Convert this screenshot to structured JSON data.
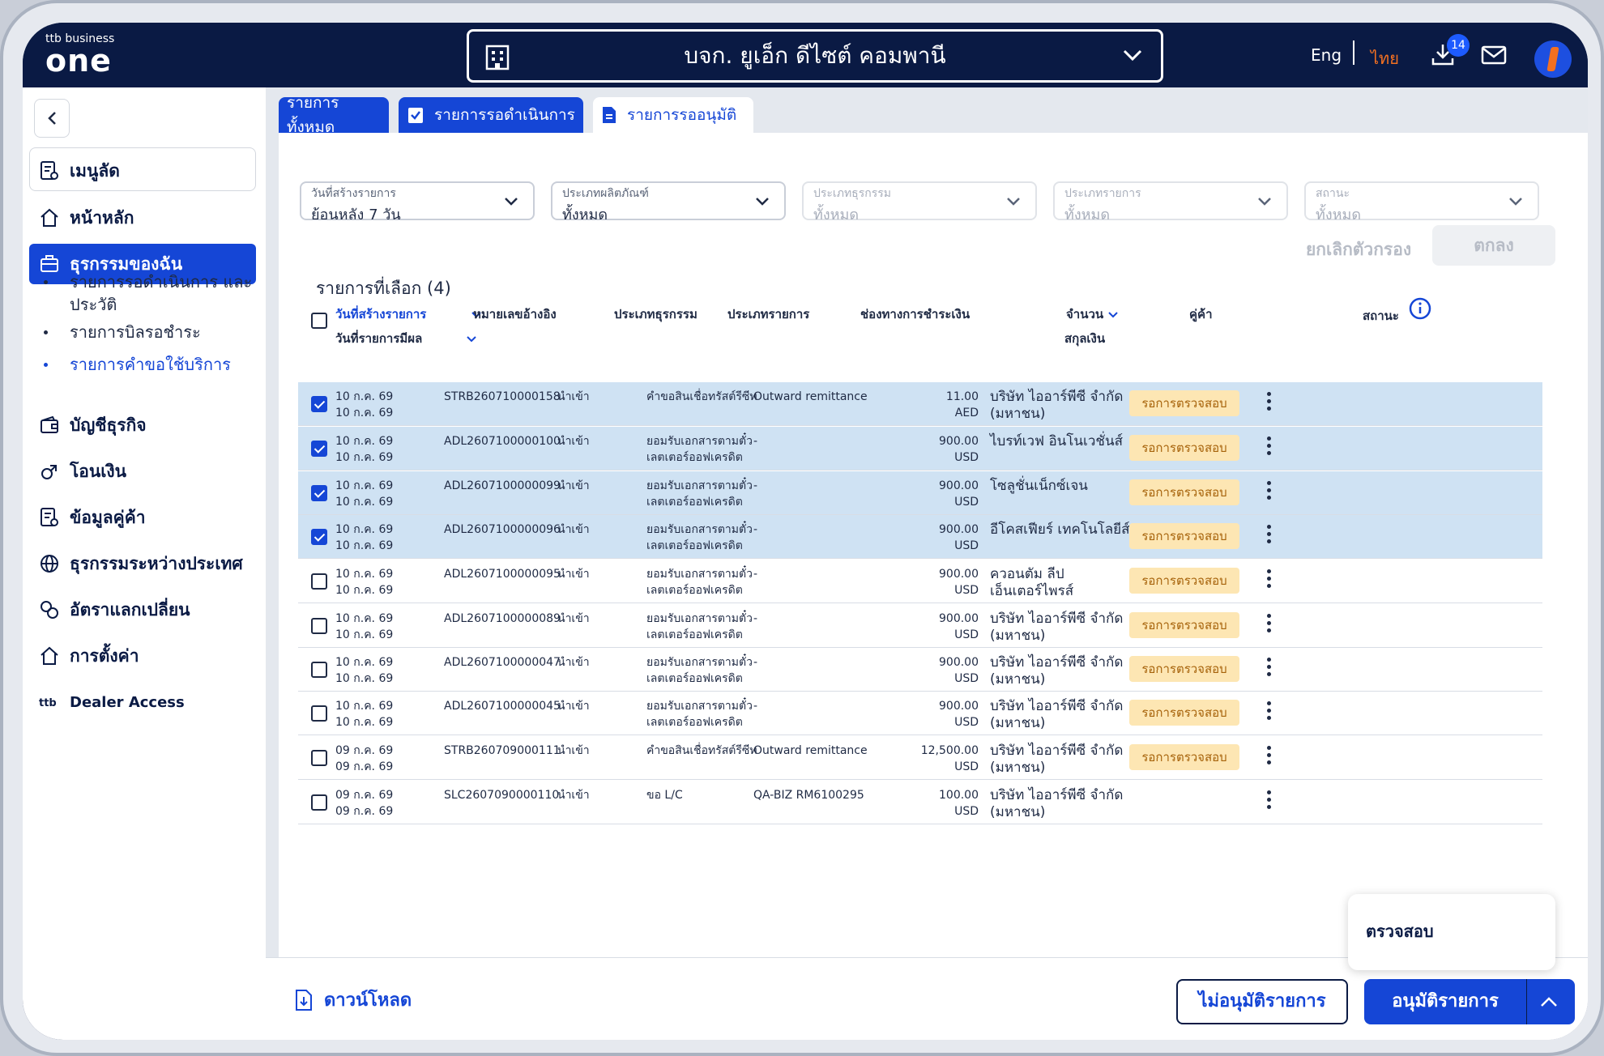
{
  "header": {
    "logo_top": "ttb business",
    "logo_main": "one",
    "company": "บจก. ยูเอ็ก ดีไซต์ คอมพานี",
    "lang_en": "Eng",
    "lang_th": "ไทย",
    "download_badge": "14",
    "colors": {
      "navy": "#0a1a44",
      "accent": "#f37021",
      "primary": "#1546d6"
    }
  },
  "sidebar": {
    "shortcut": "เมนูลัด",
    "items": [
      {
        "label": "หน้าหลัก",
        "icon": "home-icon"
      },
      {
        "label": "ธุรกรรมของฉัน",
        "icon": "briefcase-icon"
      },
      {
        "label": "บัญชีธุรกิจ",
        "icon": "wallet-icon"
      },
      {
        "label": "โอนเงิน",
        "icon": "transfer-icon"
      },
      {
        "label": "ข้อมูลคู่ค้า",
        "icon": "document-icon"
      },
      {
        "label": "ธุรกรรมระหว่างประเทศ",
        "icon": "globe-icon"
      },
      {
        "label": "อัตราแลกเปลี่ยน",
        "icon": "exchange-icon"
      },
      {
        "label": "การตั้งค่า",
        "icon": "settings-icon"
      },
      {
        "label": "Dealer Access",
        "icon": "ttb-icon"
      }
    ],
    "sub_items": [
      {
        "label": "รายการรอดำเนินการ และประวัติ"
      },
      {
        "label": "รายการบิลรอชำระ"
      },
      {
        "label": "รายการคำขอใช้บริการ"
      }
    ]
  },
  "tabs": {
    "all": "รายการทั้งหมด",
    "pending": "รายการรอดำเนินการ",
    "approve": "รายการรออนุมัติ"
  },
  "filters": [
    {
      "label": "วันที่สร้างรายการ",
      "value": "ย้อนหลัง 7 วัน"
    },
    {
      "label": "ประเภทผลิตภัณฑ์",
      "value": "ทั้งหมด"
    },
    {
      "label": "ประเภทธุรกรรม",
      "value": "ทั้งหมด"
    },
    {
      "label": "ประเภทรายการ",
      "value": "ทั้งหมด"
    },
    {
      "label": "สถานะ",
      "value": "ทั้งหมด"
    }
  ],
  "filter_actions": {
    "clear": "ยกเลิกตัวกรอง",
    "ok": "ตกลง"
  },
  "selected_count": "รายการที่เลือก (4)",
  "table": {
    "headers": {
      "created": "วันที่สร้างรายการ",
      "effective": "วันที่รายการมีผล",
      "ref": "หมายเลขอ้างอิง",
      "txn_type": "ประเภทธุรกรรม",
      "item_type": "ประเภทรายการ",
      "channel": "ช่องทางการชำระเงิน",
      "amount": "จำนวน",
      "currency": "สกุลเงิน",
      "partner": "คู่ค้า",
      "status": "สถานะ"
    },
    "rows": [
      {
        "checked": true,
        "created": "10 ก.ค. 69",
        "effective": "10 ก.ค. 69",
        "ref": "STRB260710000158",
        "txn": "นำเข้า",
        "item1": "คำขอสินเชื่อทรัสต์รีซีท",
        "item2": "",
        "channel": "Outward remittance",
        "amount": "11.00",
        "currency": "AED",
        "partner1": "บริษัท ไออาร์พีซี จำกัด",
        "partner2": "(มหาชน)",
        "status": "รอการตรวจสอบ"
      },
      {
        "checked": true,
        "created": "10 ก.ค. 69",
        "effective": "10 ก.ค. 69",
        "ref": "ADL2607100000100",
        "txn": "นำเข้า",
        "item1": "ยอมรับเอกสารตามตั๋ว",
        "item2": "เลตเตอร์ออฟเครดิต",
        "channel": "-",
        "amount": "900.00",
        "currency": "USD",
        "partner1": "ไบรท์เวฟ อินโนเวชั่นส์",
        "partner2": "",
        "status": "รอการตรวจสอบ"
      },
      {
        "checked": true,
        "created": "10 ก.ค. 69",
        "effective": "10 ก.ค. 69",
        "ref": "ADL2607100000099",
        "txn": "นำเข้า",
        "item1": "ยอมรับเอกสารตามตั๋ว",
        "item2": "เลตเตอร์ออฟเครดิต",
        "channel": "-",
        "amount": "900.00",
        "currency": "USD",
        "partner1": "โซลูชั่นเน็กซ์เจน",
        "partner2": "",
        "status": "รอการตรวจสอบ"
      },
      {
        "checked": true,
        "created": "10 ก.ค. 69",
        "effective": "10 ก.ค. 69",
        "ref": "ADL2607100000096",
        "txn": "นำเข้า",
        "item1": "ยอมรับเอกสารตามตั๋ว",
        "item2": "เลตเตอร์ออฟเครดิต",
        "channel": "-",
        "amount": "900.00",
        "currency": "USD",
        "partner1": "อีโคสเฟียร์ เทคโนโลยีส์",
        "partner2": "",
        "status": "รอการตรวจสอบ"
      },
      {
        "checked": false,
        "created": "10 ก.ค. 69",
        "effective": "10 ก.ค. 69",
        "ref": "ADL2607100000095",
        "txn": "นำเข้า",
        "item1": "ยอมรับเอกสารตามตั๋ว",
        "item2": "เลตเตอร์ออฟเครดิต",
        "channel": "-",
        "amount": "900.00",
        "currency": "USD",
        "partner1": "ควอนตัม ลีป",
        "partner2": "เอ็นเตอร์ไพรส์",
        "status": "รอการตรวจสอบ"
      },
      {
        "checked": false,
        "created": "10 ก.ค. 69",
        "effective": "10 ก.ค. 69",
        "ref": "ADL2607100000089",
        "txn": "นำเข้า",
        "item1": "ยอมรับเอกสารตามตั๋ว",
        "item2": "เลตเตอร์ออฟเครดิต",
        "channel": "-",
        "amount": "900.00",
        "currency": "USD",
        "partner1": "บริษัท ไออาร์พีซี จำกัด",
        "partner2": "(มหาชน)",
        "status": "รอการตรวจสอบ"
      },
      {
        "checked": false,
        "created": "10 ก.ค. 69",
        "effective": "10 ก.ค. 69",
        "ref": "ADL2607100000047",
        "txn": "นำเข้า",
        "item1": "ยอมรับเอกสารตามตั๋ว",
        "item2": "เลตเตอร์ออฟเครดิต",
        "channel": "-",
        "amount": "900.00",
        "currency": "USD",
        "partner1": "บริษัท ไออาร์พีซี จำกัด",
        "partner2": "(มหาชน)",
        "status": "รอการตรวจสอบ"
      },
      {
        "checked": false,
        "created": "10 ก.ค. 69",
        "effective": "10 ก.ค. 69",
        "ref": "ADL2607100000045",
        "txn": "นำเข้า",
        "item1": "ยอมรับเอกสารตามตั๋ว",
        "item2": "เลตเตอร์ออฟเครดิต",
        "channel": "-",
        "amount": "900.00",
        "currency": "USD",
        "partner1": "บริษัท ไออาร์พีซี จำกัด",
        "partner2": "(มหาชน)",
        "status": "รอการตรวจสอบ"
      },
      {
        "checked": false,
        "created": "09 ก.ค. 69",
        "effective": "09 ก.ค. 69",
        "ref": "STRB260709000111",
        "txn": "นำเข้า",
        "item1": "คำขอสินเชื่อทรัสต์รีซีท",
        "item2": "",
        "channel": "Outward remittance",
        "amount": "12,500.00",
        "currency": "USD",
        "partner1": "บริษัท ไออาร์พีซี จำกัด",
        "partner2": "(มหาชน)",
        "status": "รอการตรวจสอบ"
      },
      {
        "checked": false,
        "created": "09 ก.ค. 69",
        "effective": "09 ก.ค. 69",
        "ref": "SLC2607090000110",
        "txn": "นำเข้า",
        "item1": "ขอ L/C",
        "item2": "",
        "channel": "QA-BIZ RM6100295",
        "amount": "100.00",
        "currency": "USD",
        "partner1": "บริษัท ไออาร์พีซี จำกัด",
        "partner2": "(มหาชน)",
        "status": ""
      }
    ]
  },
  "bottom": {
    "download": "ดาวน์โหลด",
    "reject": "ไม่อนุมัติรายการ",
    "approve": "อนุมัติรายการ",
    "menu_item": "ตรวจสอบ"
  }
}
